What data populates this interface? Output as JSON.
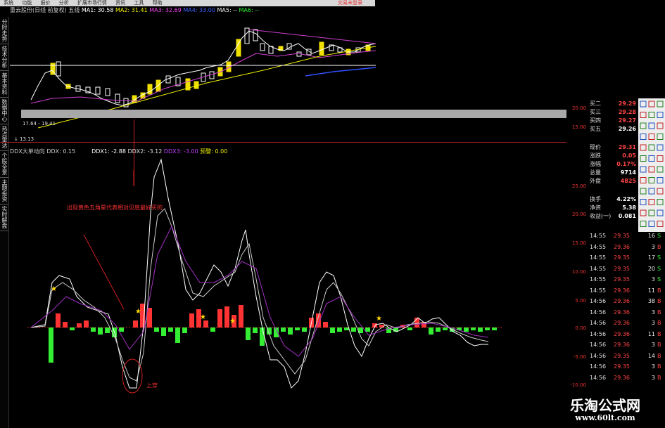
{
  "menu": {
    "items": [
      "系统",
      "功能",
      "报价",
      "分析",
      "扩展市场行情",
      "资讯",
      "工具",
      "帮助"
    ]
  },
  "top_link": "交易未登录",
  "left_tabs": [
    "分时走势",
    "技术分析",
    "基本资料",
    "数据中心",
    "热点雷达",
    "个股全景",
    "主题投资",
    "实时解盘"
  ],
  "kline": {
    "stock": "重云股份(日线 前复权) 五线",
    "ma1": "MA1: 30.58",
    "ma2": "MA2: 31.41",
    "ma3": "MA3: 32.69",
    "ma4": "MA4: 33.00",
    "ma5": "MA5: --",
    "ma6": "MA6: --",
    "low_label": "17.64 - 19.41",
    "bottom_label": "↓ 13.13"
  },
  "indicator": {
    "name": "DDX大单动向",
    "ddx": "DDX: 0.15",
    "ddx1": "DDX1: -2.88",
    "ddx2": "DDX2: -3.12",
    "ddx3": "DDX3: -3.00",
    "warn": "预警: 0.00"
  },
  "annotations": {
    "note1": "出现黄色五角星代表相对见底最好买的",
    "note2": "上穿"
  },
  "scale": {
    "top_ticks": [
      "20.00",
      "15.00"
    ],
    "ticks": [
      "25.00",
      "20.00",
      "15.00",
      "10.00",
      "5.00",
      "0.00",
      "-5.00",
      "-10.00"
    ]
  },
  "quote": [
    {
      "label": "买二",
      "value": "29.29"
    },
    {
      "label": "买三",
      "value": "29.28"
    },
    {
      "label": "买四",
      "value": "29.27"
    },
    {
      "label": "买五",
      "value": "29.26"
    },
    {
      "label": "现价",
      "value": "29.31"
    },
    {
      "label": "涨跌",
      "value": "0.05"
    },
    {
      "label": "涨幅",
      "value": "0.17%"
    },
    {
      "label": "总量",
      "value": "9714"
    },
    {
      "label": "外盘",
      "value": "4825"
    },
    {
      "label": "换手",
      "value": "4.22%"
    },
    {
      "label": "净资",
      "value": "5.38"
    },
    {
      "label": "收益(一)",
      "value": "0.081"
    }
  ],
  "trades": [
    {
      "time": "14:55",
      "price": "29.35",
      "vol": "16",
      "side": "S"
    },
    {
      "time": "14:55",
      "price": "29.36",
      "vol": "3",
      "side": "B"
    },
    {
      "time": "14:55",
      "price": "29.35",
      "vol": "17",
      "side": "S"
    },
    {
      "time": "14:55",
      "price": "29.35",
      "vol": "20",
      "side": "S"
    },
    {
      "time": "14:55",
      "price": "29.35",
      "vol": "3",
      "side": "S"
    },
    {
      "time": "14:55",
      "price": "29.36",
      "vol": "11",
      "side": "B"
    },
    {
      "time": "14:56",
      "price": "29.36",
      "vol": "38",
      "side": "B"
    },
    {
      "time": "14:56",
      "price": "29.36",
      "vol": "3",
      "side": "B"
    },
    {
      "time": "14:56",
      "price": "29.36",
      "vol": "3",
      "side": "B"
    },
    {
      "time": "14:56",
      "price": "29.36",
      "vol": "11",
      "side": "B"
    },
    {
      "time": "14:56",
      "price": "29.36",
      "vol": "3",
      "side": "B"
    },
    {
      "time": "14:56",
      "price": "29.35",
      "vol": "14",
      "side": "B"
    },
    {
      "time": "14:56",
      "price": "29.35",
      "vol": "3",
      "side": "B"
    },
    {
      "time": "14:56",
      "price": "29.36",
      "vol": "3",
      "side": "B"
    }
  ],
  "watermark": {
    "title": "乐淘公式网",
    "url": "www.60lt.com"
  },
  "colors": {
    "rise": "#ff3333",
    "fall": "#33ee33",
    "star": "#ffd700",
    "ddx1": "#ffffff",
    "ddx3": "#b040ff"
  }
}
